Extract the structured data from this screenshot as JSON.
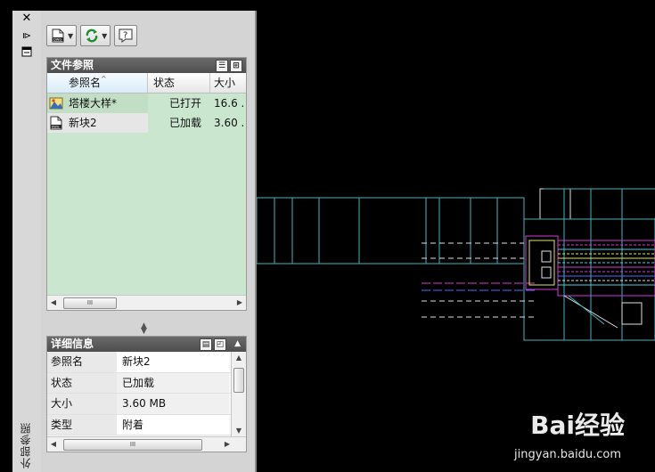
{
  "palette": {
    "vertical_title": "外部参照",
    "strip_buttons": [
      "close-icon",
      "autohide-icon",
      "properties-icon"
    ],
    "toolbar": {
      "attach_icon": "attach-dwg-icon",
      "refresh_icon": "refresh-icon",
      "help_icon": "help-icon"
    }
  },
  "file_refs": {
    "title": "文件参照",
    "columns": {
      "name": "参照名",
      "status": "状态",
      "size": "大小"
    },
    "rows": [
      {
        "name": "塔楼大样*",
        "status": "已打开",
        "size": "16.6 ...",
        "icon": "drawing-master-icon"
      },
      {
        "name": "新块2",
        "status": "已加载",
        "size": "3.60 ...",
        "icon": "dwg-file-icon"
      }
    ],
    "scroll_thumb": "III"
  },
  "details": {
    "title": "详细信息",
    "rows": [
      {
        "key": "参照名",
        "value": "新块2"
      },
      {
        "key": "状态",
        "value": "已加载"
      },
      {
        "key": "大小",
        "value": "3.60 MB"
      },
      {
        "key": "类型",
        "value": "附着"
      }
    ],
    "scroll_thumb": "III"
  },
  "watermark": {
    "brand": "Bai经验",
    "url": "jingyan.baidu.com"
  },
  "colors": {
    "canvas": "#000000",
    "list_bg": "#cbe6cf",
    "header_bg": "#555555",
    "cad_cyan": "#4fd1d9",
    "cad_magenta": "#d43cd4",
    "cad_white": "#e8e8e8"
  }
}
